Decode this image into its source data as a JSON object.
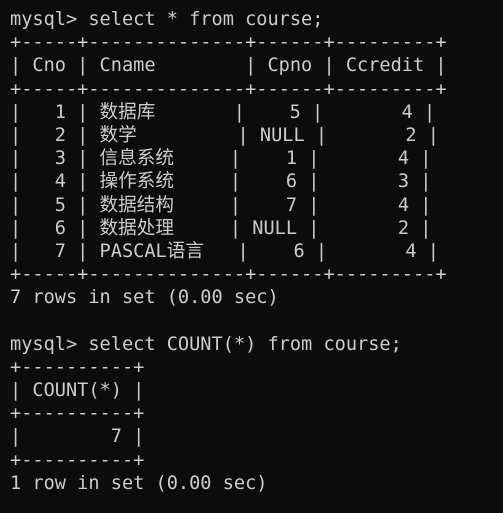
{
  "terminal": {
    "lines": [
      "mysql> select * from course;",
      "+-----+--------------+------+---------+",
      "| Cno | Cname        | Cpno | Ccredit |",
      "+-----+--------------+------+---------+",
      "|   1 | 数据库       |    5 |       4 |",
      "|   2 | 数学         | NULL |       2 |",
      "|   3 | 信息系统     |    1 |       4 |",
      "|   4 | 操作系统     |    6 |       3 |",
      "|   5 | 数据结构     |    7 |       4 |",
      "|   6 | 数据处理     | NULL |       2 |",
      "|   7 | PASCAL语言   |    6 |       4 |",
      "+-----+--------------+------+---------+",
      "7 rows in set (0.00 sec)",
      "",
      "mysql> select COUNT(*) from course;",
      "+----------+",
      "| COUNT(*) |",
      "+----------+",
      "|        7 |",
      "+----------+",
      "1 row in set (0.00 sec)"
    ]
  }
}
